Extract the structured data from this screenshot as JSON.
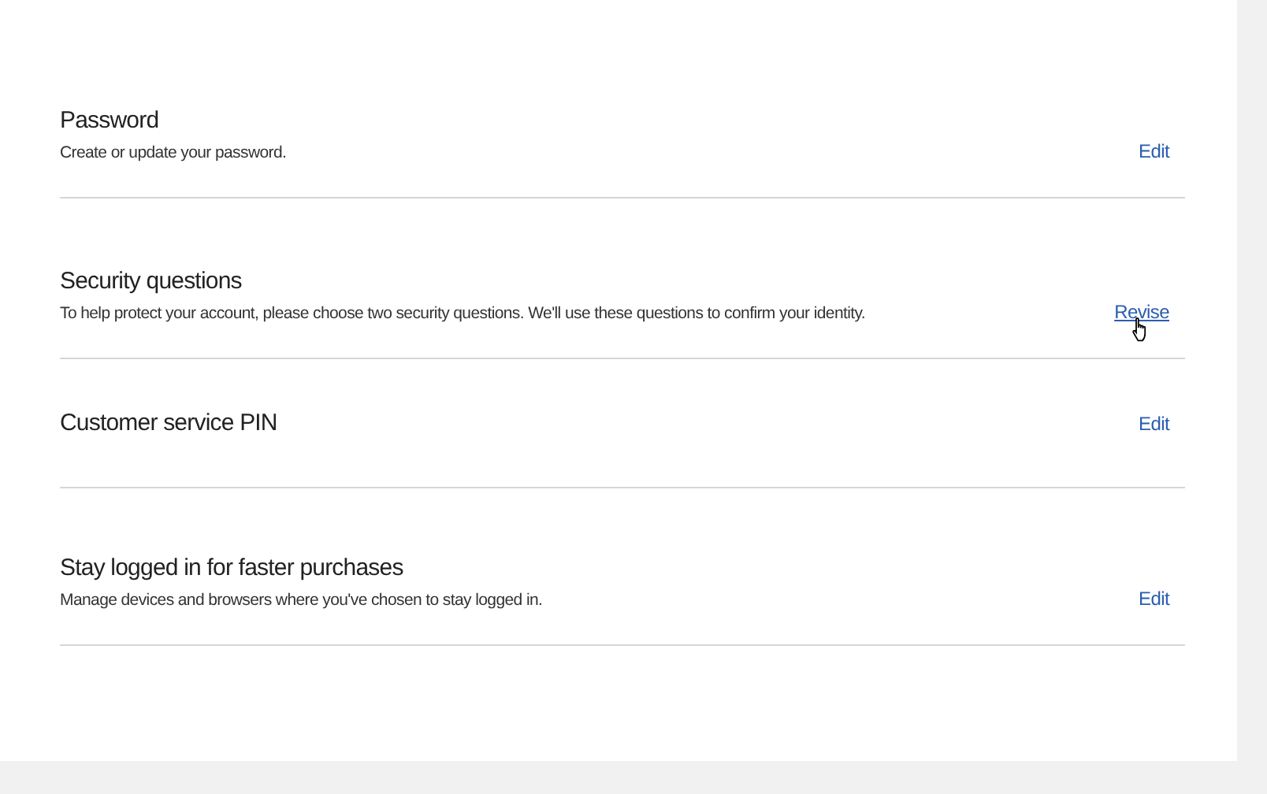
{
  "sections": [
    {
      "title": "Password",
      "description": "Create or update your password.",
      "action": {
        "label": "Edit",
        "hovered": false
      }
    },
    {
      "title": "Security questions",
      "description": "To help protect your account, please choose two security questions. We'll use these questions to confirm your identity.",
      "action": {
        "label": "Revise",
        "hovered": true
      }
    },
    {
      "title": "Customer service PIN",
      "action": {
        "label": "Edit",
        "hovered": false
      }
    },
    {
      "title": "Stay logged in for faster purchases",
      "description": "Manage devices and browsers where you've chosen to stay logged in.",
      "action": {
        "label": "Edit",
        "hovered": false
      }
    }
  ]
}
